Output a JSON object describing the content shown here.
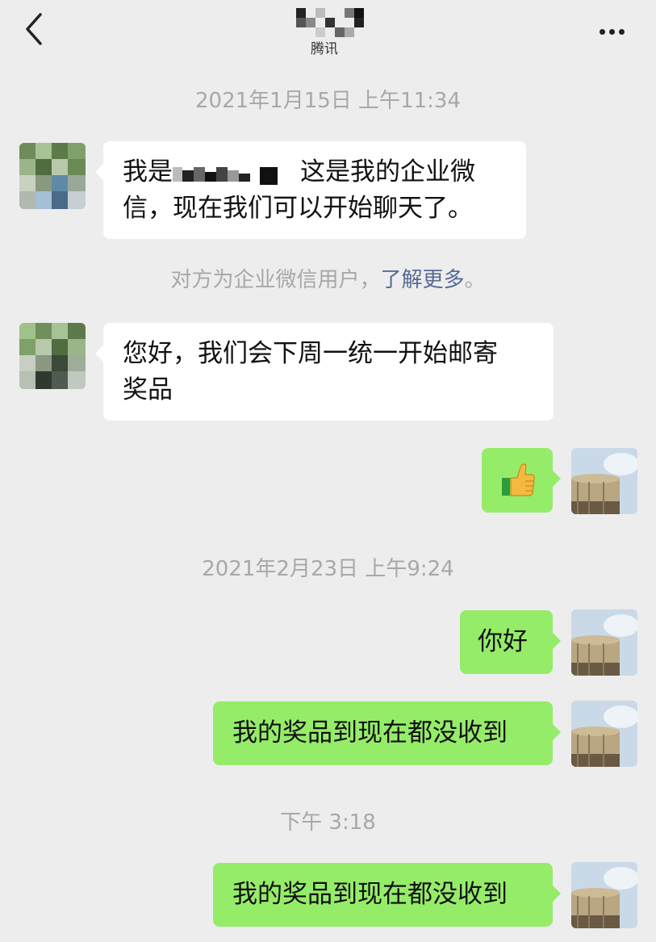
{
  "header": {
    "title_suffix": "腾讯",
    "back_icon": "chevron-left-icon",
    "more_icon": "ellipsis-icon"
  },
  "messages": {
    "time1": "2021年1月15日 上午11:34",
    "msg1_prefix": "我是",
    "msg1_rest": "这是我的企业微",
    "msg1_line2": "信，现在我们可以开始聊天了。",
    "notice_text": "对方为企业微信用户，",
    "notice_link": "了解更多",
    "notice_end": "。",
    "msg2_line1": "您好，我们会下周一统一开始邮寄",
    "msg2_line2": "奖品",
    "msg3_emoji": "thumbs-up-emoji",
    "time2": "2021年2月23日 上午9:24",
    "msg4": "你好",
    "msg5": "我的奖品到现在都没收到",
    "time3": "下午 3:18",
    "msg6": "我的奖品到现在都没收到"
  },
  "colors": {
    "background": "#ededed",
    "my_bubble": "#95ec69",
    "their_bubble": "#ffffff",
    "link": "#576b95",
    "timestamp": "#a8a8a8"
  }
}
